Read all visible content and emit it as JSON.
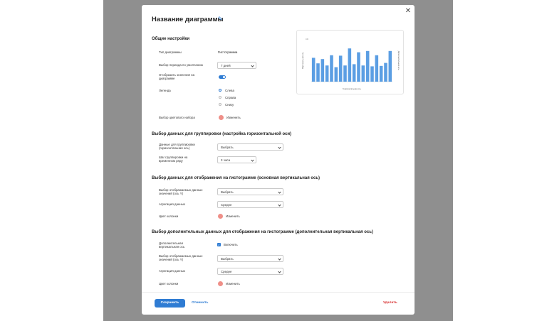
{
  "dialog": {
    "title": "Название диаграммы",
    "general": {
      "heading": "Общие настройки",
      "chart_type_label": "Тип диаграммы",
      "chart_type_value": "Гистограмма",
      "period_label": "Выбор периода по умолчанию",
      "period_value": "7 дней",
      "show_values_label": "Отобразить значения на диаграмме",
      "legend_label": "Легенда",
      "legend_options": [
        "Слева",
        "Справа",
        "Снизу"
      ],
      "color_set_label": "Выбор цветового набора",
      "color_set_action": "Изменить"
    },
    "grouping": {
      "heading": "Выбор данных для группировки (настройка горизонтальной оси)",
      "data_label": "Данные для группировки (горизонтальная ось)",
      "data_value": "Выбрать",
      "step_label": "Шаг группировки на временном ряду",
      "step_value": "3 часа"
    },
    "primary": {
      "heading": "Выбор данных для отображения на гистограмме (основная вертикальная ось)",
      "values_label": "Выбор отображаемых данных значений (ось Y)",
      "values_value": "Выбрать",
      "agg_label": "Агрегация данных",
      "agg_value": "Средне",
      "color_label": "Цвет колонки",
      "color_action": "Изменить"
    },
    "secondary": {
      "heading": "Выбор дополнительных данных для отображения на гистограмме (дополнительная вертикальная ось)",
      "axis_label": "Дополнительная вертикальная ось",
      "axis_enable": "Включить",
      "values_label": "Выбор отображаемых данных значений (ось Y)",
      "values_value": "Выбрать",
      "agg_label": "Агрегация данных",
      "agg_value": "Средне",
      "color_label": "Цвет колонки",
      "color_action": "Изменить"
    },
    "footer": {
      "save": "Сохранить",
      "cancel": "Отменить",
      "delete": "Удалить"
    }
  },
  "colors": {
    "accent": "#2f7cd3",
    "bar": "#5b9ee3",
    "swatch": "#ef8f88",
    "danger": "#d93636"
  },
  "icons": {
    "close": "close-icon",
    "edit": "pencil-icon"
  },
  "chart_data": {
    "type": "bar",
    "title": "",
    "xlabel": "Горизонтальная ось",
    "ylabel": "Вертикальная ось",
    "y2label": "Дополнительная ось",
    "ytick_top": "100",
    "values": [
      56,
      43,
      53,
      38,
      62,
      34,
      61,
      38,
      78,
      41,
      69,
      38,
      72,
      36,
      62,
      37,
      44,
      72
    ],
    "ylim": [
      0,
      100
    ],
    "grid": false,
    "legend": "none"
  }
}
